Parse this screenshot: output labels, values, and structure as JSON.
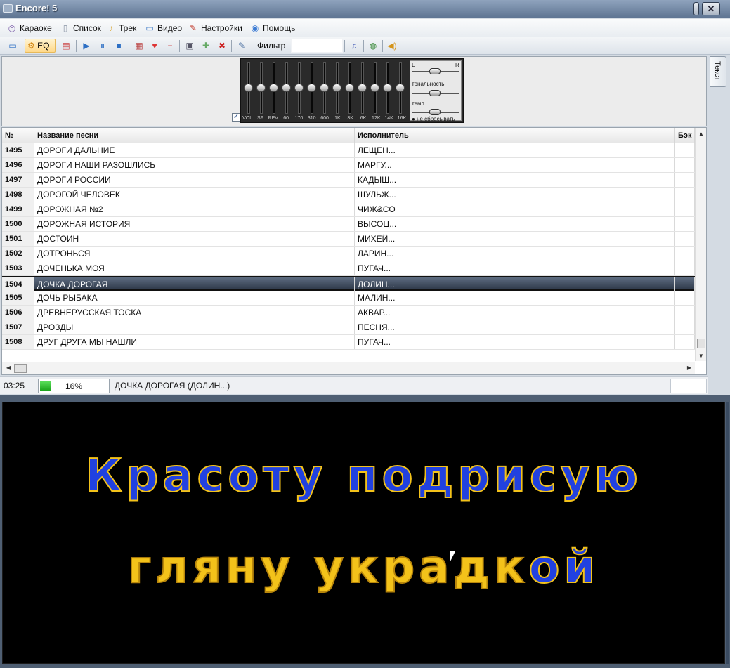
{
  "window": {
    "title": "Encore! 5"
  },
  "menu": {
    "items": [
      {
        "label": "Караоке",
        "icon": "karaoke-icon"
      },
      {
        "label": "Список",
        "icon": "list-icon"
      },
      {
        "label": "Трек",
        "icon": "track-icon"
      },
      {
        "label": "Видео",
        "icon": "video-icon"
      },
      {
        "label": "Настройки",
        "icon": "settings-icon"
      },
      {
        "label": "Помощь",
        "icon": "help-icon"
      }
    ]
  },
  "toolbar": {
    "eq_label": "EQ",
    "filter_label": "Фильтр",
    "filter_value": ""
  },
  "equalizer": {
    "labels": [
      "VOL",
      "SF",
      "REV",
      "60",
      "170",
      "310",
      "600",
      "1K",
      "3K",
      "6K",
      "12K",
      "14K",
      "16K"
    ],
    "levels": [
      0.5,
      0.5,
      0.5,
      0.5,
      0.5,
      0.5,
      0.5,
      0.5,
      0.5,
      0.5,
      0.5,
      0.5,
      0.5
    ],
    "tone_label": "тональность",
    "tempo_label": "темп",
    "no_reset_label": "не сбрасывать",
    "left_channel": "L",
    "right_channel": "R",
    "checkbox_checked": true
  },
  "side_tab": {
    "label": "Текст"
  },
  "table": {
    "columns": [
      "№",
      "Название песни",
      "Исполнитель",
      "Бэк"
    ],
    "rows": [
      {
        "num": "1495",
        "song": "ДОРОГИ ДАЛЬНИЕ",
        "artist": "ЛЕЩЕН...",
        "back": ""
      },
      {
        "num": "1496",
        "song": "ДОРОГИ НАШИ РАЗОШЛИСЬ",
        "artist": "МАРГУ...",
        "back": ""
      },
      {
        "num": "1497",
        "song": "ДОРОГИ РОССИИ",
        "artist": "КАДЫШ...",
        "back": ""
      },
      {
        "num": "1498",
        "song": "ДОРОГОЙ ЧЕЛОВЕК",
        "artist": "ШУЛЬЖ...",
        "back": ""
      },
      {
        "num": "1499",
        "song": "ДОРОЖНАЯ №2",
        "artist": "ЧИЖ&CO",
        "back": ""
      },
      {
        "num": "1500",
        "song": "ДОРОЖНАЯ ИСТОРИЯ",
        "artist": "ВЫСОЦ...",
        "back": ""
      },
      {
        "num": "1501",
        "song": "ДОСТОИН",
        "artist": "МИХЕЙ...",
        "back": ""
      },
      {
        "num": "1502",
        "song": "ДОТРОНЬСЯ",
        "artist": "ЛАРИН...",
        "back": ""
      },
      {
        "num": "1503",
        "song": "ДОЧЕНЬКА МОЯ",
        "artist": "ПУГАЧ...",
        "back": ""
      },
      {
        "num": "1504",
        "song": "ДОЧКА ДОРОГАЯ",
        "artist": "ДОЛИН...",
        "back": "",
        "selected": true
      },
      {
        "num": "1505",
        "song": "ДОЧЬ РЫБАКА",
        "artist": "МАЛИН...",
        "back": ""
      },
      {
        "num": "1506",
        "song": "ДРЕВНЕРУССКАЯ ТОСКА",
        "artist": "АКВАР...",
        "back": ""
      },
      {
        "num": "1507",
        "song": "ДРОЗДЫ",
        "artist": "ПЕСНЯ...",
        "back": ""
      },
      {
        "num": "1508",
        "song": "ДРУГ ДРУГА МЫ НАШЛИ",
        "artist": "ПУГАЧ...",
        "back": ""
      }
    ]
  },
  "status": {
    "time": "03:25",
    "progress_text": "16%",
    "progress_fraction": 0.16,
    "now_playing": "ДОЧКА ДОРОГАЯ (ДОЛИН...)"
  },
  "lyrics": {
    "line1_sung": "Красоту подрисую",
    "line2_unsung": "гляну украдк",
    "line2_sung": "ой"
  },
  "colors": {
    "lyric_sung": "#2141e0",
    "lyric_unsung": "#f3c21a",
    "selected_row": "#3d4859",
    "progress_fill": "#17a017"
  }
}
